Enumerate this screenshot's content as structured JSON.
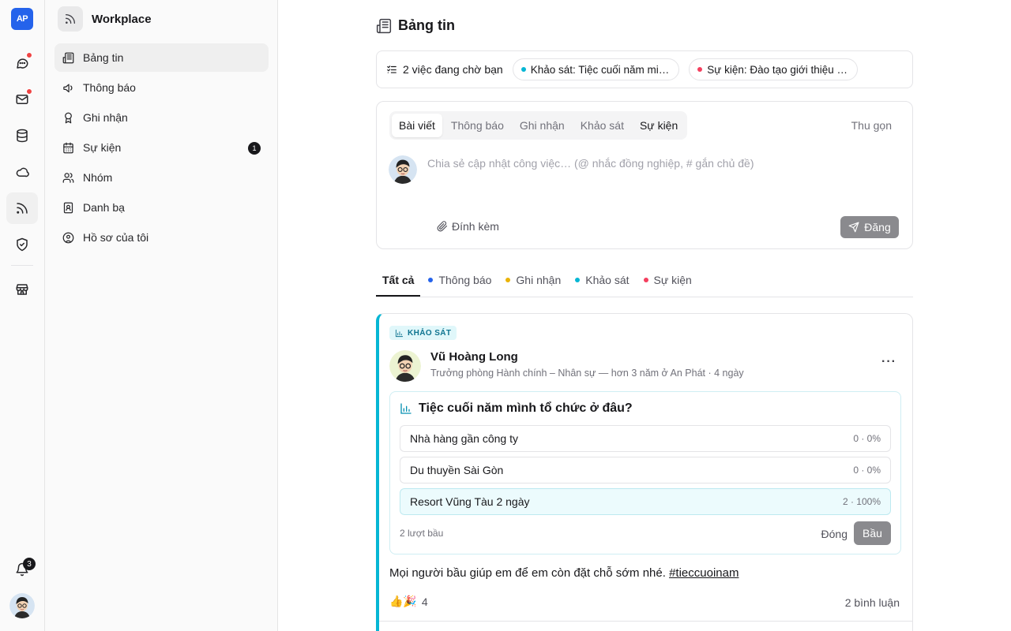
{
  "rail": {
    "logo": "AP",
    "items": [
      {
        "icon": "chat-icon",
        "dot": true
      },
      {
        "icon": "mail-icon",
        "dot": true
      },
      {
        "icon": "database-icon",
        "dot": false
      },
      {
        "icon": "cloud-icon",
        "dot": false
      },
      {
        "icon": "rss-icon",
        "dot": false,
        "active": true
      },
      {
        "icon": "shield-check-icon",
        "dot": false
      },
      {
        "icon": "store-icon",
        "dot": false
      }
    ],
    "notifications_count": "3"
  },
  "sidebar": {
    "workspace_title": "Workplace",
    "items": [
      {
        "label": "Bảng tin",
        "icon": "newspaper-icon",
        "active": true
      },
      {
        "label": "Thông báo",
        "icon": "megaphone-icon"
      },
      {
        "label": "Ghi nhận",
        "icon": "award-icon"
      },
      {
        "label": "Sự kiện",
        "icon": "calendar-icon",
        "badge": "1"
      },
      {
        "label": "Nhóm",
        "icon": "users-icon"
      },
      {
        "label": "Danh bạ",
        "icon": "contact-book-icon"
      },
      {
        "label": "Hồ sơ của tôi",
        "icon": "user-circle-icon"
      }
    ]
  },
  "main": {
    "page_title": "Bảng tin",
    "pending": {
      "label": "2 việc đang chờ bạn",
      "chips": [
        {
          "text": "Khảo sát: Tiệc cuối năm mi…",
          "color": "#06b6d4"
        },
        {
          "text": "Sự kiện: Đào tạo giới thiệu …",
          "color": "#f43f5e"
        }
      ]
    },
    "composer": {
      "tabs": [
        "Bài viết",
        "Thông báo",
        "Ghi nhận",
        "Khảo sát",
        "Sự kiện"
      ],
      "collapse_label": "Thu gọn",
      "placeholder": "Chia sẻ cập nhật công việc… (@ nhắc đồng nghiệp, # gắn chủ đề)",
      "attach_label": "Đính kèm",
      "post_label": "Đăng"
    },
    "filter_tabs": [
      {
        "label": "Tất cả",
        "active": true
      },
      {
        "label": "Thông báo",
        "color": "#2563eb"
      },
      {
        "label": "Ghi nhận",
        "color": "#eab308"
      },
      {
        "label": "Khảo sát",
        "color": "#06b6d4"
      },
      {
        "label": "Sự kiện",
        "color": "#f43f5e"
      }
    ],
    "post": {
      "tag": "KHẢO SÁT",
      "author": "Vũ Hoàng Long",
      "meta": "Trưởng phòng Hành chính – Nhân sự — hơn 3 năm ở An Phát · 4 ngày",
      "poll_question": "Tiệc cuối năm mình tổ chức ở đâu?",
      "options": [
        {
          "label": "Nhà hàng gần công ty",
          "result": "0 · 0%",
          "votes": 0,
          "percent": 0
        },
        {
          "label": "Du thuyền Sài Gòn",
          "result": "0 · 0%",
          "votes": 0,
          "percent": 0
        },
        {
          "label": "Resort Vũng Tàu 2 ngày",
          "result": "2 · 100%",
          "votes": 2,
          "percent": 100,
          "selected": true
        }
      ],
      "votes_label": "2 lượt bầu",
      "close_label": "Đóng",
      "vote_label": "Bầu",
      "body_text": "Mọi người bầu giúp em để em còn đặt chỗ sớm nhé.",
      "hashtag": "#tieccuoinam",
      "reaction_emojis": "👍🎉",
      "reaction_count": "4",
      "comments_label": "2 bình luận"
    }
  }
}
